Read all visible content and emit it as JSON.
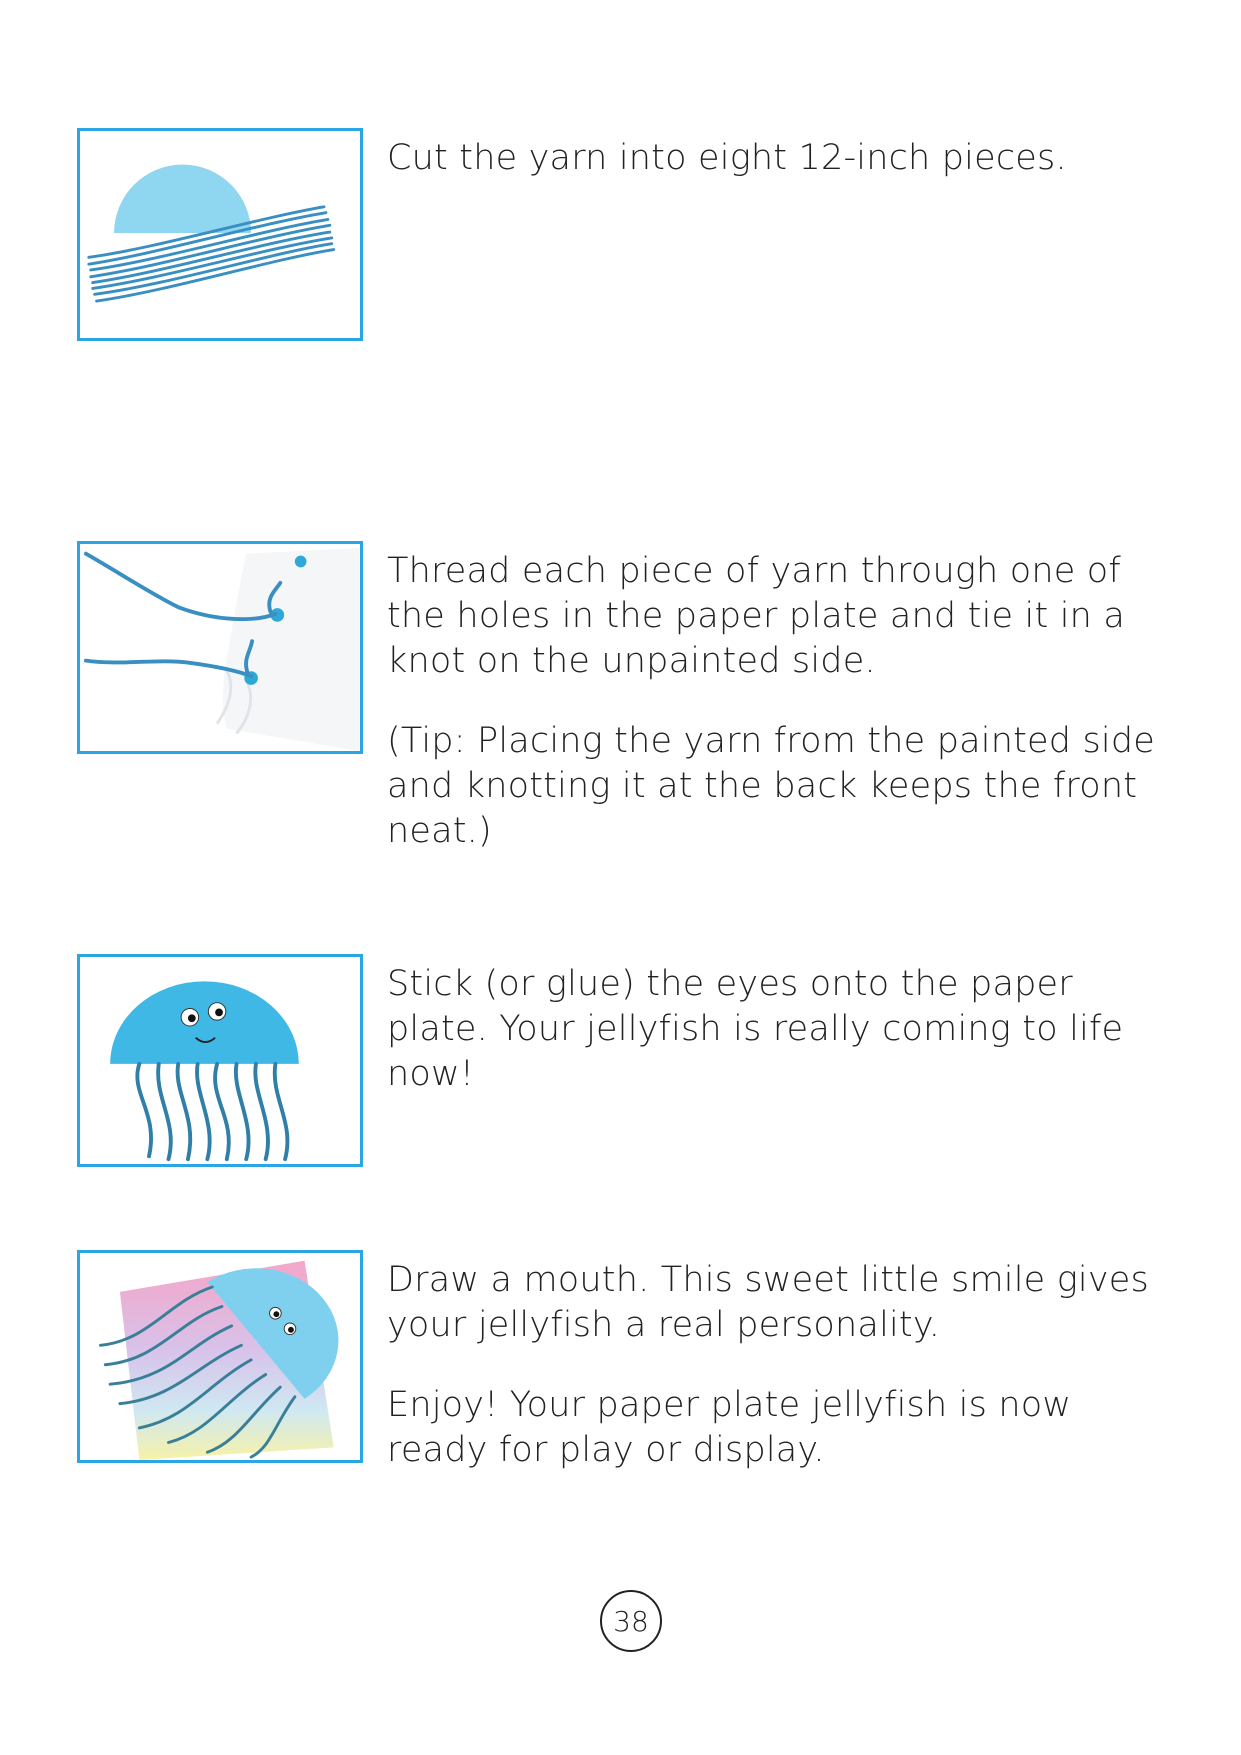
{
  "steps": [
    {
      "photo": "paper-plate-and-yarn-pieces",
      "paragraphs": [
        "Cut the yarn into eight 12-inch pieces."
      ]
    },
    {
      "photo": "yarn-threaded-through-plate-holes",
      "paragraphs": [
        "Thread each piece of yarn through one of the holes in the paper plate and tie it in a knot on the unpainted side.",
        "(Tip: Placing the yarn from the painted side and knotting it at the back keeps the front neat.)"
      ]
    },
    {
      "photo": "jellyfish-with-eyes",
      "paragraphs": [
        "Stick (or glue) the eyes onto the paper plate. Your jellyfish is really coming to life now!"
      ]
    },
    {
      "photo": "finished-jellyfish-on-rainbow-paper",
      "paragraphs": [
        "Draw a mouth. This sweet little smile gives your jellyfish a real personality.",
        "Enjoy! Your paper plate jellyfish is now ready for play or display."
      ]
    }
  ],
  "page_number": "38",
  "colors": {
    "frame": "#29a6e3",
    "plate": "#7fd0ee",
    "plate_dark": "#3fb8e6",
    "yarn": "#3a8fc2"
  }
}
